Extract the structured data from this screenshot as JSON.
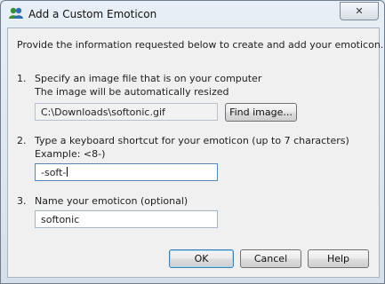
{
  "window": {
    "title": "Add a Custom Emoticon",
    "close_glyph": "✕",
    "app_icon": "people-icon"
  },
  "intro": "Provide the information requested below to create and add your emoticon.",
  "step1": {
    "number": "1.",
    "line1": "Specify an image file that is on your computer",
    "line2": "The image will be automatically resized",
    "path_value": "C:\\Downloads\\softonic.gif",
    "find_label": "Find image..."
  },
  "step2": {
    "number": "2.",
    "line1": "Type a keyboard shortcut for your emoticon (up to 7 characters)",
    "line2": "Example: <8-)",
    "shortcut_value": "-soft-"
  },
  "step3": {
    "number": "3.",
    "line1": "Name your emoticon (optional)",
    "name_value": "softonic"
  },
  "buttons": {
    "ok": "OK",
    "cancel": "Cancel",
    "help": "Help"
  }
}
